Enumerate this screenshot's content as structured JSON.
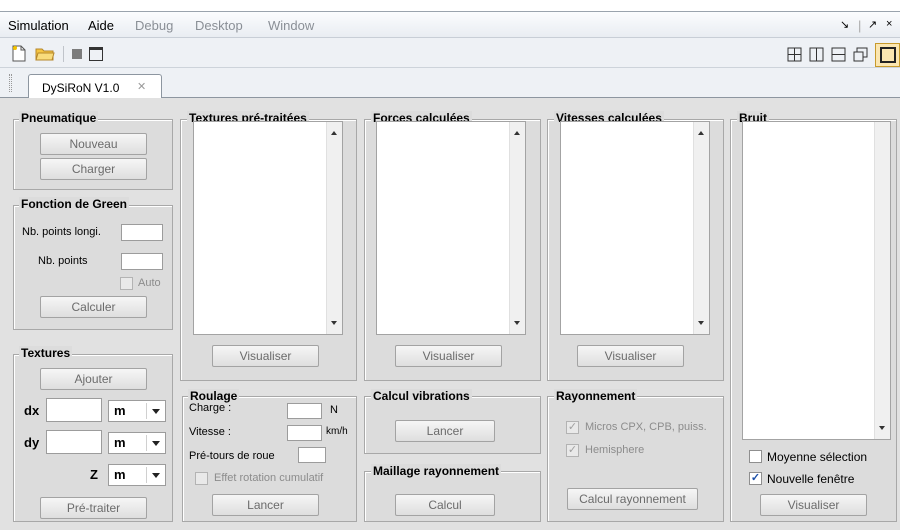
{
  "menubar": {
    "items": [
      "Simulation",
      "Aide",
      "Debug",
      "Desktop",
      "Window"
    ],
    "window_controls": [
      "↘",
      "↗",
      "×"
    ]
  },
  "toolbar": {
    "icons": [
      "new-file-icon",
      "open-folder-icon",
      "stop-icon",
      "window-icon"
    ],
    "layout_icons": [
      "grid-icon",
      "split-vertical-icon",
      "split-horizontal-icon",
      "float-icon",
      "maximize-icon"
    ]
  },
  "tab": {
    "label": "DySiRoN V1.0",
    "close": "✕"
  },
  "pneumatique": {
    "title": "Pneumatique",
    "nouveau": "Nouveau",
    "charger": "Charger"
  },
  "green": {
    "title": "Fonction de Green",
    "nb_points_longi": "Nb. points longi.",
    "nb_points": "Nb. points",
    "auto": "Auto",
    "calculer": "Calculer"
  },
  "textures": {
    "title": "Textures",
    "ajouter": "Ajouter",
    "dx": "dx",
    "dy": "dy",
    "z": "Z",
    "unit": "m",
    "pre_traiter": "Pré-traiter"
  },
  "textures_pretraitees": {
    "title": "Textures pré-traitées",
    "visualiser": "Visualiser"
  },
  "forces": {
    "title": "Forces calculées",
    "visualiser": "Visualiser"
  },
  "vitesses": {
    "title": "Vitesses calculées",
    "visualiser": "Visualiser"
  },
  "bruit": {
    "title": "Bruit",
    "moyenne": "Moyenne sélection",
    "nouvelle": "Nouvelle fenêtre",
    "nouvelle_checked": "✓",
    "visualiser": "Visualiser"
  },
  "roulage": {
    "title": "Roulage",
    "charge": "Charge :",
    "charge_unit": "N",
    "vitesse": "Vitesse :",
    "vitesse_unit": "km/h",
    "pretours": "Pré-tours de roue",
    "effet": "Effet rotation cumulatif",
    "lancer": "Lancer"
  },
  "vibrations": {
    "title": "Calcul vibrations",
    "lancer": "Lancer"
  },
  "maillage": {
    "title": "Maillage rayonnement",
    "calcul": "Calcul"
  },
  "rayonnement": {
    "title": "Rayonnement",
    "micros": "Micros CPX, CPB, puiss.",
    "hemisphere": "Hemisphere",
    "checked": "✓",
    "calcul": "Calcul rayonnement"
  }
}
